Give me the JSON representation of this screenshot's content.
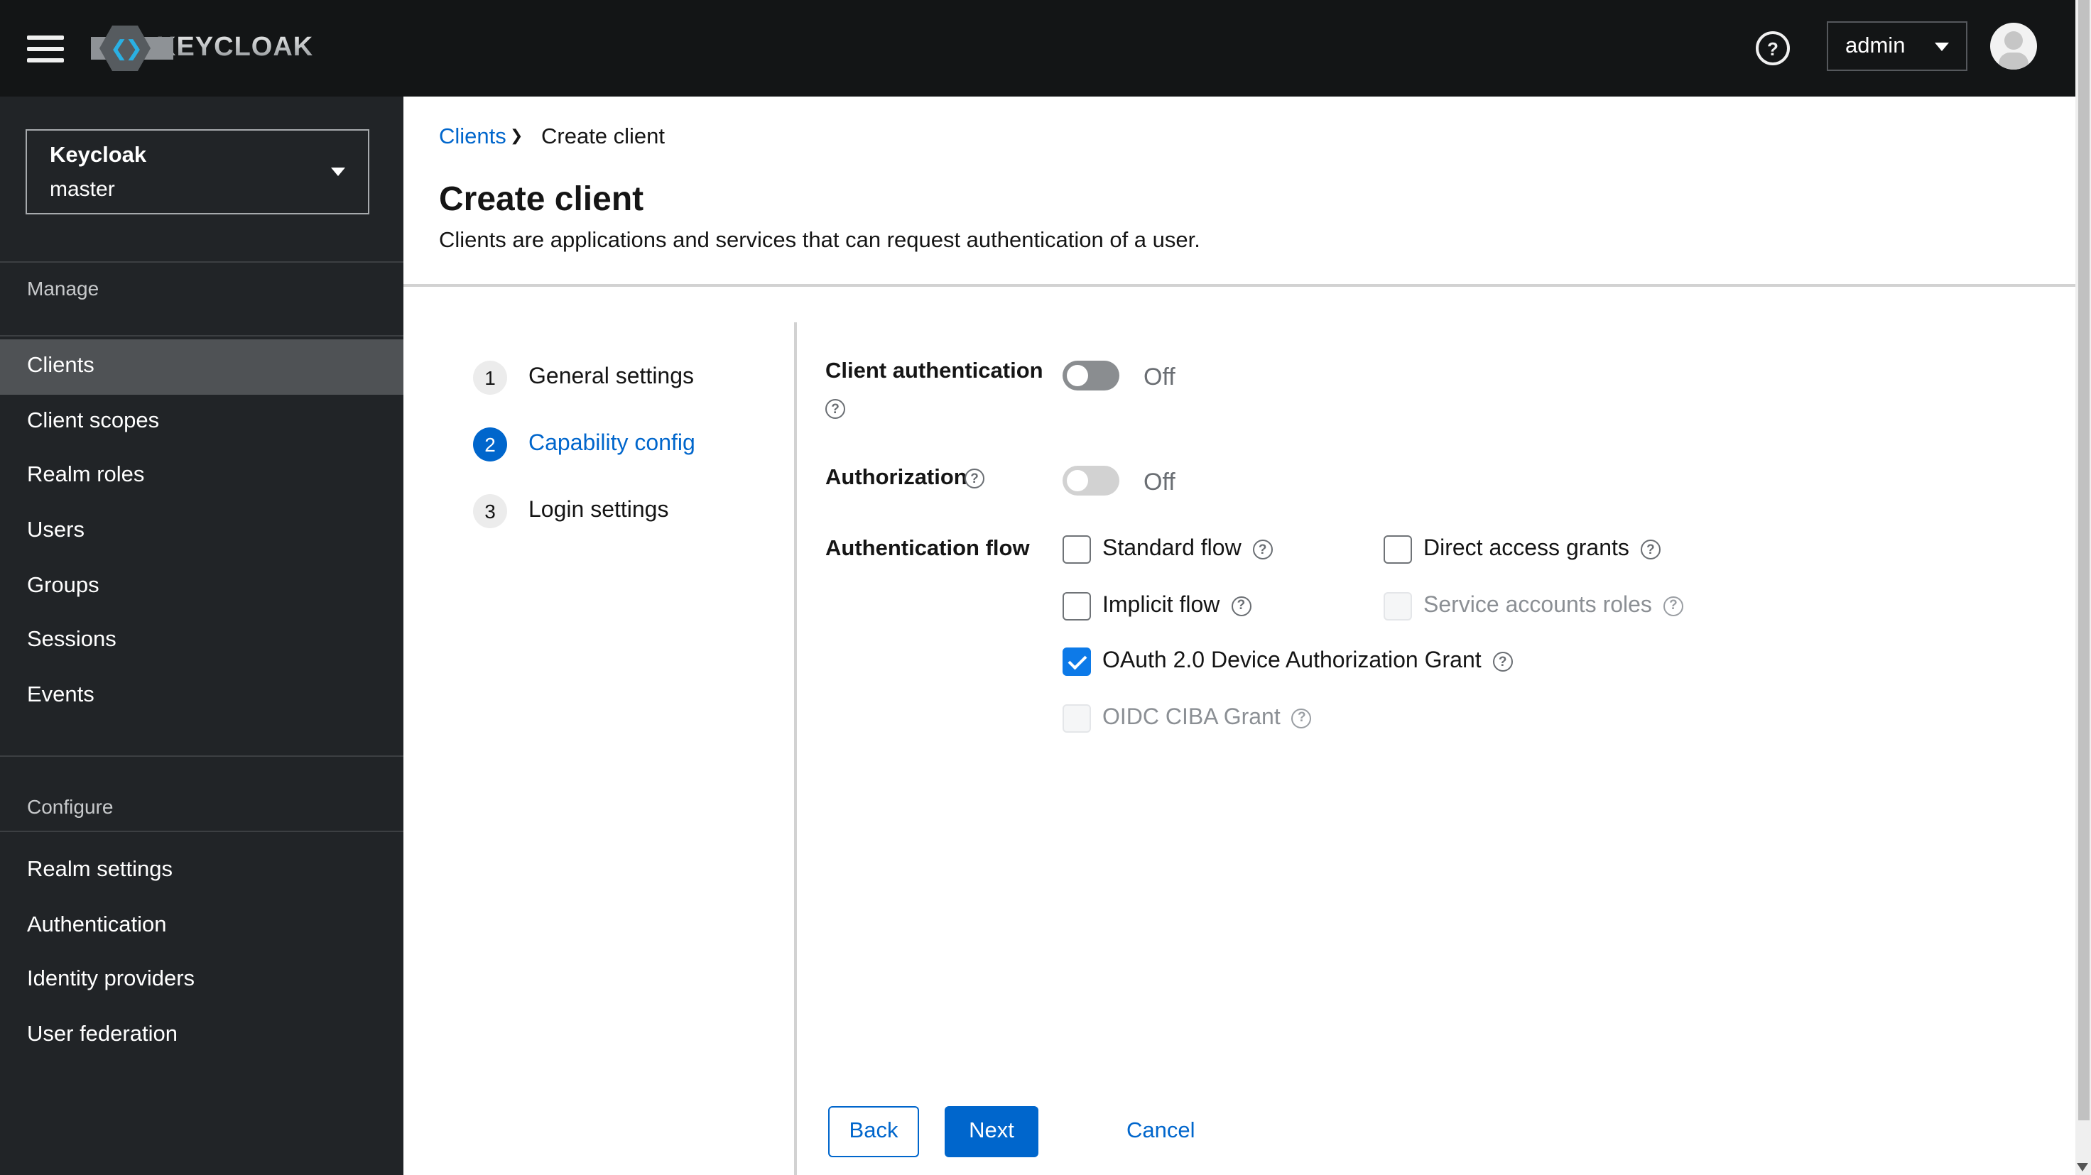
{
  "colors": {
    "primary": "#0066cc",
    "checkbox_checked": "#0d7ae8",
    "topbar_bg": "#131516",
    "sidebar_bg": "#212427",
    "selected_nav_bg": "#4f5255",
    "divider": "#d2d2d2",
    "toggle_off_bg": "#8a8d90",
    "toggle_disabled_bg": "#d2d2d2"
  },
  "topbar": {
    "brand": "KEYCLOAK",
    "user_menu_label": "admin"
  },
  "sidebar": {
    "realm_switcher": {
      "name": "Keycloak",
      "realm": "master"
    },
    "sections": [
      {
        "label": "Manage",
        "selected_item": "Clients",
        "items": [
          "Clients",
          "Client scopes",
          "Realm roles",
          "Users",
          "Groups",
          "Sessions",
          "Events"
        ]
      },
      {
        "label": "Configure",
        "items": [
          "Realm settings",
          "Authentication",
          "Identity providers",
          "User federation"
        ]
      }
    ]
  },
  "breadcrumb": {
    "items": [
      "Clients",
      "Create client"
    ]
  },
  "page_header": {
    "title": "Create client",
    "subtitle": "Clients are applications and services that can request authentication of a user."
  },
  "wizard": {
    "steps": [
      {
        "num": "1",
        "label": "General settings",
        "state": "inactive"
      },
      {
        "num": "2",
        "label": "Capability config",
        "state": "active"
      },
      {
        "num": "3",
        "label": "Login settings",
        "state": "inactive"
      }
    ]
  },
  "form": {
    "client_authentication": {
      "label": "Client authentication",
      "value": "Off",
      "state": "off"
    },
    "authorization": {
      "label": "Authorization",
      "value": "Off",
      "state": "off-disabled"
    },
    "authentication_flow": {
      "label": "Authentication flow",
      "options": [
        {
          "label": "Standard flow",
          "checked": false,
          "disabled": false
        },
        {
          "label": "Direct access grants",
          "checked": false,
          "disabled": false
        },
        {
          "label": "Implicit flow",
          "checked": false,
          "disabled": false
        },
        {
          "label": "Service accounts roles",
          "checked": false,
          "disabled": true
        },
        {
          "label": "OAuth 2.0 Device Authorization Grant",
          "checked": true,
          "disabled": false
        },
        {
          "label": "OIDC CIBA Grant",
          "checked": false,
          "disabled": true
        }
      ]
    }
  },
  "footer": {
    "back": "Back",
    "next": "Next",
    "cancel": "Cancel"
  }
}
